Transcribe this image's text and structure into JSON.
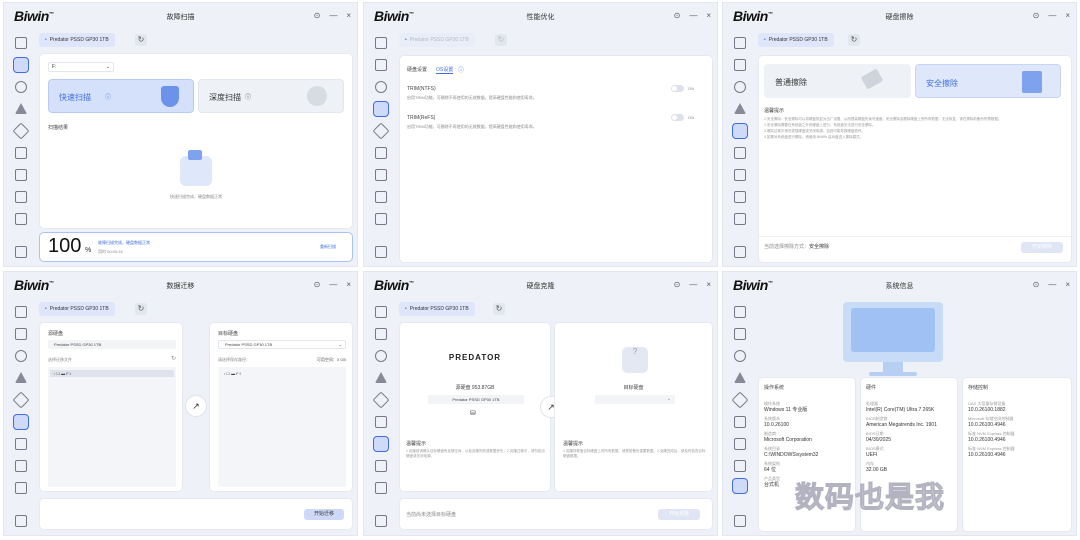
{
  "brand": "Biwin",
  "window_controls": [
    "⊙",
    "—",
    "×"
  ],
  "device": "Predator PSSD GP30 1TB",
  "scan": {
    "title": "故障扫描",
    "drive": "F:",
    "quick_scan": "快速扫描",
    "deep_scan": "深度扫描",
    "results_label": "扫描结果",
    "result_msg": "快速扫描完成，硬盘数据正常",
    "progress_pct": "100",
    "pct_sign": "%",
    "done_status": "故障扫描完成，硬盘数据正常",
    "elapsed": "用时 00:00:16",
    "rescan": "重新扫描"
  },
  "optimize": {
    "title": "性能优化",
    "tab_disk": "硬盘设置",
    "tab_os": "OS设置",
    "trim_ntfs_title": "TRIM(NTFS)",
    "trim_ntfs_desc": "启用TRIM功能，可删除不再使用的无效数据，提高硬盘性能和使用寿命。",
    "trim_refs_title": "TRIM(ReFS)",
    "trim_refs_desc": "启用TRIM功能，可删除不再使用的无效数据，提高硬盘性能和使用寿命。",
    "on1": "ON",
    "on2": "ON"
  },
  "erase": {
    "title": "硬盘擦除",
    "normal": "普通擦除",
    "secure": "安全擦除",
    "notice_title": "温馨提示",
    "notes": [
      "1.安全擦除：安全擦除可以将硬盘恢复为出厂设置，从而提高硬盘的读写速度。安全擦除会删除硬盘上的所有数据，无法恢复，请在擦除前备份所需数据。",
      "2.安全擦除需要在系统盘之外的硬盘上进行，系统盘无法进行安全擦除。",
      "3.擦除过程中请勿拔插硬盘或关闭电源，否则可能导致硬盘损坏。",
      "4.如需对系统盘进行擦除，请使用 BIWIN 启动盘进入擦除模式。"
    ],
    "mode_label": "当前选择擦除方式：",
    "mode_value": "安全擦除",
    "start": "开始擦除"
  },
  "migrate": {
    "title": "数据迁移",
    "source_label": "源硬盘",
    "source_drive": "Predator PSSD GP30 1TB",
    "select_files": "选择迁移文件",
    "src_item": "F:/",
    "target_label": "目标硬盘",
    "target_drive": "Predator PSSD GP30 1TB",
    "path_label": "请选择保存路径：",
    "available": "可用空间：0 GB",
    "tgt_item": "F:/",
    "start": "开始迁移"
  },
  "clone": {
    "title": "硬盘克隆",
    "vendor": "PREDATOR",
    "source_size": "源硬盘 953.87GB",
    "source_drive": "Predator PSSD GP30 1TB",
    "target_label": "目标硬盘",
    "notice_title": "温馨提示",
    "notice_left": "1.克隆前请确认目标硬盘有足够空间，以免克隆失败或数据丢失。2.克隆过程中，请勿拔出硬盘或关闭电源。",
    "notice_right": "1.克隆将覆盖目标硬盘上的所有数据，请提前备份重要数据。2.克隆完成后，请及时检查目标硬盘数据。",
    "footer": "当前尚未选择目标硬盘",
    "start": "开始克隆"
  },
  "sysinfo": {
    "title": "系统信息",
    "os_header": "操作系统",
    "hw_header": "硬件",
    "storage_header": "存储控制",
    "os_rows": [
      {
        "k": "操作系统",
        "v": "Windows 11 专业版"
      },
      {
        "k": "系统版本",
        "v": "10.0.26100"
      },
      {
        "k": "制造商",
        "v": "Microsoft Corporation"
      },
      {
        "k": "系统目录",
        "v": "C:\\WINDOWS\\system32"
      },
      {
        "k": "系统架构",
        "v": "64 位"
      },
      {
        "k": "产品类型",
        "v": "台式机"
      }
    ],
    "hw_rows": [
      {
        "k": "处理器",
        "v": "Intel(R) Core(TM) Ultra 7 265K"
      },
      {
        "k": "BIOS制造商",
        "v": "American Megatrends Inc. 1901"
      },
      {
        "k": "BIOS日期",
        "v": "04/30/2025"
      },
      {
        "k": "BIOS模式",
        "v": "UEFI"
      },
      {
        "k": "内存",
        "v": "32.00 GB"
      }
    ],
    "st_rows": [
      {
        "k": "UAS 大容量存储设备",
        "v": "10.0.26100.1882"
      },
      {
        "k": "Microsoft 存储空间控制器",
        "v": "10.0.26100.4946"
      },
      {
        "k": "标准 NVM Express 控制器",
        "v": "10.0.26100.4946"
      },
      {
        "k": "标准 NVM Express 控制器",
        "v": "10.0.26100.4946"
      }
    ]
  },
  "watermark": "数码也是我"
}
